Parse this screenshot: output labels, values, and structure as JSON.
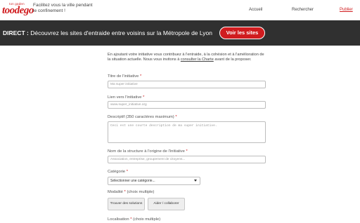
{
  "header": {
    "logo_small": "ton gaden",
    "logo_main": "toodego",
    "tagline": "Facilitez vous la ville pendant le confinement !",
    "nav": [
      {
        "label": "Accueil"
      },
      {
        "label": "Rechercher"
      },
      {
        "label": "Publier"
      }
    ]
  },
  "banner": {
    "prefix": "DIRECT :",
    "text": " Découvrez les sites d'entraide entre voisins sur la Métropole de Lyon",
    "button_label": "Voir les sites"
  },
  "form": {
    "intro_text": "En ajoutant votre initiative vous contribuez à l'entraide, à la cohésion et à l'amélioration de la situation actuelle. Nous vous invitons à ",
    "intro_link": "consulter la Charte",
    "intro_end": " avant de la proposer.",
    "required_mark": "*",
    "title_label": "Titre de l'initiative",
    "title_placeholder": "Ma super initiative",
    "link_label": "Lien vers l'initiative",
    "link_placeholder": "www.super_initiative.org",
    "desc_label": "Descriptif (350 caractères maximum)",
    "desc_placeholder": "Ceci est une courte description de ma super initiative.",
    "org_label": "Nom de la structure à l'origine de l'initiative",
    "org_placeholder": "Association, entreprise, groupement de citoyens...",
    "category_label": "Catégorie",
    "category_value": "Sélectionner une catégorie...",
    "modality_label": "Modalité",
    "modality_hint": "(choix multiple)",
    "modality_options": [
      "Trouver des solutions",
      "Aider / collaborer"
    ],
    "location_label": "Localisation",
    "location_hint": "(choix multiple)"
  },
  "colors": {
    "brand": "#d01c1f",
    "banner_bg": "#303030"
  }
}
